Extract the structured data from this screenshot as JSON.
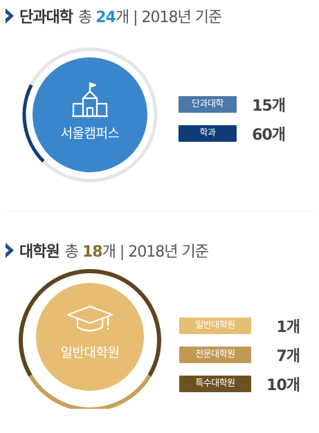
{
  "colleges": {
    "title": "단과대학",
    "total_prefix": "총",
    "total_value": "24",
    "total_unit": "개",
    "separator": "|",
    "basis": "2018년 기준",
    "center_label": "서울캠퍼스",
    "legend": [
      {
        "label": "단과대학",
        "count": "15개",
        "value": 15,
        "color": "#4a78a8"
      },
      {
        "label": "학과",
        "count": "60개",
        "value": 60,
        "color": "#0f3c78"
      }
    ],
    "accent": "#2a8fd0",
    "circle_color": "#3a86cc",
    "ring_fill_fraction": 0.2
  },
  "graduate": {
    "title": "대학원",
    "total_prefix": "총",
    "total_value": "18",
    "total_unit": "개",
    "separator": "|",
    "basis": "2018년 기준",
    "center_label": "일반대학원",
    "legend": [
      {
        "label": "일반대학원",
        "count": "1개",
        "value": 1,
        "color": "#e5bf74"
      },
      {
        "label": "전문대학원",
        "count": "7개",
        "value": 7,
        "color": "#c19a57"
      },
      {
        "label": "특수대학원",
        "count": "10개",
        "value": 10,
        "color": "#6e5123"
      }
    ],
    "accent": "#8a6a2e",
    "circle_color": "#e6bd72"
  }
}
